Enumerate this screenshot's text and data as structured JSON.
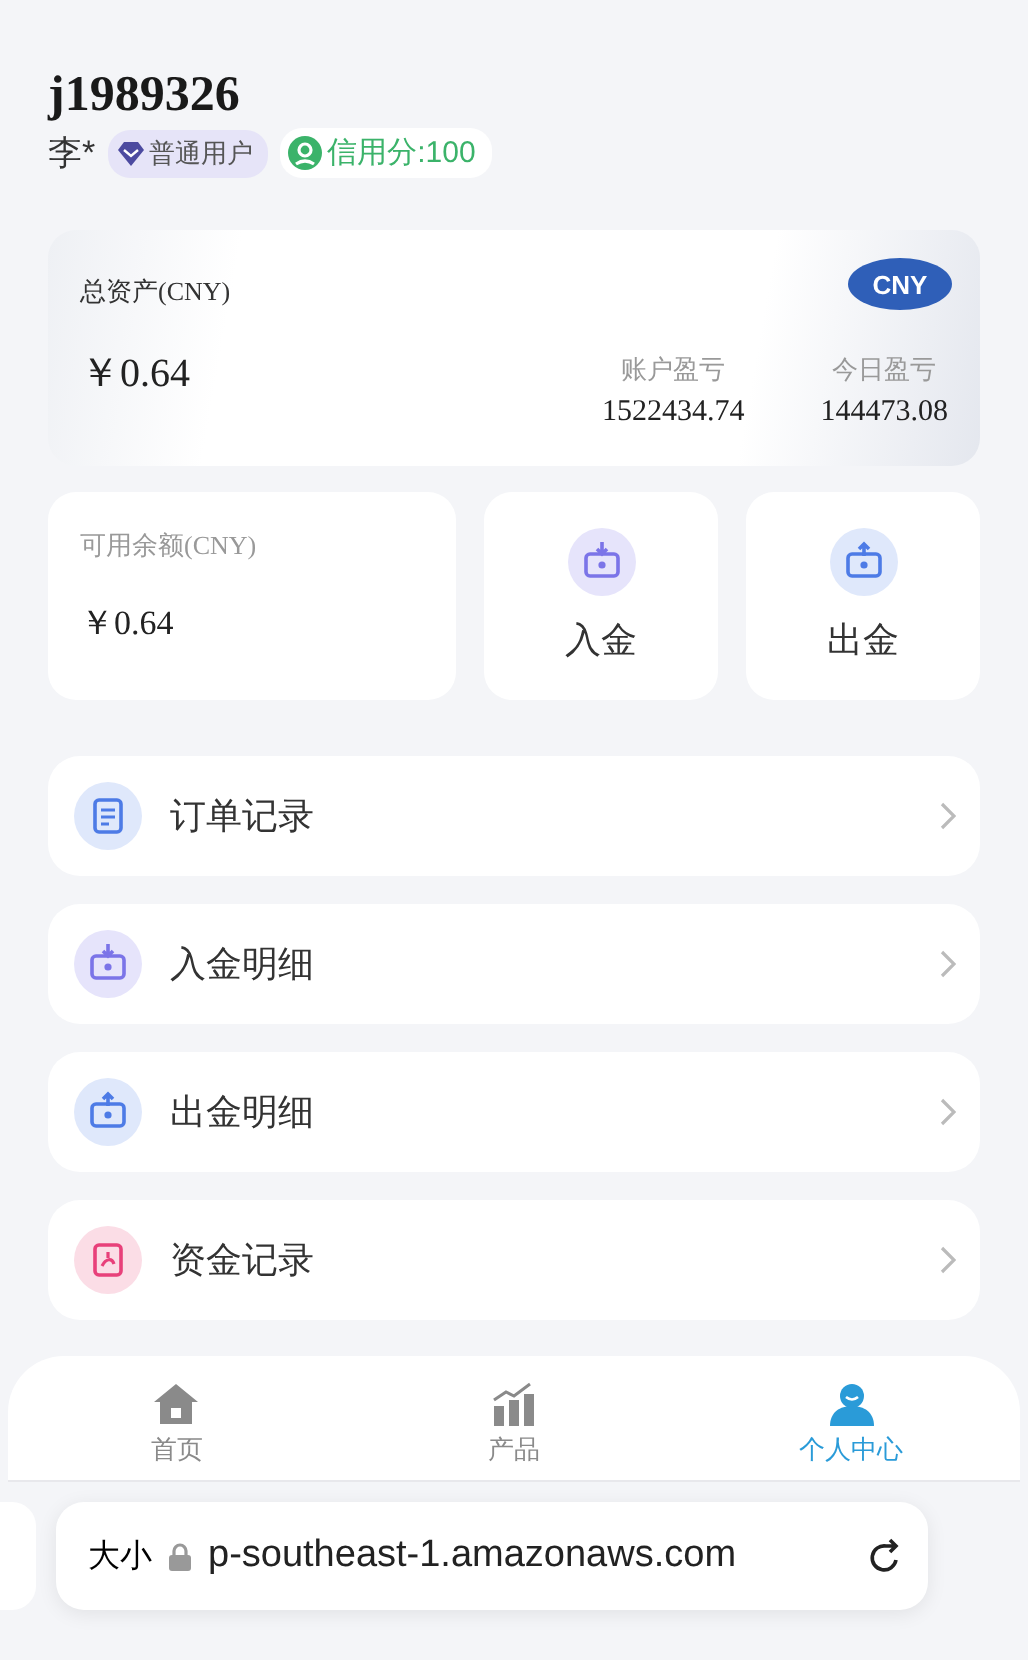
{
  "user": {
    "username": "j1989326",
    "name": "李*",
    "level_badge": "普通用户",
    "credit_badge": "信用分:100"
  },
  "assets": {
    "title": "总资产(CNY)",
    "amount": "￥0.64",
    "currency": "CNY",
    "stats": [
      {
        "label": "账户盈亏",
        "value": "1522434.74"
      },
      {
        "label": "今日盈亏",
        "value": "144473.08"
      }
    ]
  },
  "balance": {
    "label": "可用余额(CNY)",
    "amount": "￥0.64"
  },
  "actions": [
    {
      "kind": "deposit",
      "label": "入金"
    },
    {
      "kind": "withdraw",
      "label": "出金"
    }
  ],
  "menu": [
    {
      "kind": "order",
      "label": "订单记录"
    },
    {
      "kind": "deposit",
      "label": "入金明细"
    },
    {
      "kind": "withdraw",
      "label": "出金明细"
    },
    {
      "kind": "funds",
      "label": "资金记录"
    }
  ],
  "tabs": [
    {
      "kind": "home",
      "label": "首页",
      "selected": false
    },
    {
      "kind": "products",
      "label": "产品",
      "selected": false
    },
    {
      "kind": "profile",
      "label": "个人中心",
      "selected": true
    }
  ],
  "browser": {
    "text_size": "大小",
    "url": "p-southeast-1.amazonaws.com"
  }
}
